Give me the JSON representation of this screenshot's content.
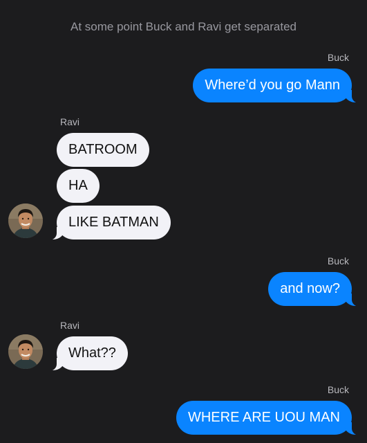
{
  "caption": "At some point Buck and Ravi get separated",
  "messages": [
    {
      "sender": "Buck",
      "text": "Where’d you go Mann"
    },
    {
      "sender": "Ravi",
      "text": "BATROOM"
    },
    {
      "text": "HA"
    },
    {
      "text": "LIKE BATMAN"
    },
    {
      "sender": "Buck",
      "text": "and now?"
    },
    {
      "sender": "Ravi",
      "text": "What??"
    },
    {
      "sender": "Buck",
      "text": "WHERE ARE UOU MAN"
    }
  ],
  "colors": {
    "background": "#1c1c1e",
    "outgoing_bubble": "#0a84ff",
    "incoming_bubble": "#f2f2f7"
  },
  "icons": {
    "avatar": "contact-photo"
  }
}
